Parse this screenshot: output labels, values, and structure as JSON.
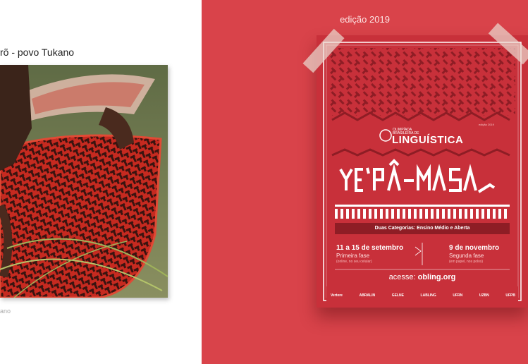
{
  "left": {
    "caption": "rõ - povo Tukano",
    "small_caption": "ano"
  },
  "right": {
    "edition": "edição 2019"
  },
  "poster": {
    "olympiad_line1": "OLIMPÍADA",
    "olympiad_line2": "BRASILEIRA DE",
    "linguistica": "LINGUÍSTICA",
    "year_tag": "edição 2019",
    "title": "YE'PÂ-MASA",
    "categories": "Duas Categorias: Ensino Médio e Aberta",
    "phase1": {
      "date": "11 a 15 de setembro",
      "label": "Primeira fase",
      "note": "(online, no seu celular)"
    },
    "phase2": {
      "date": "9 de novembro",
      "label": "Segunda fase",
      "note": "(em papel, nos polos)"
    },
    "acesse_label": "acesse:",
    "acesse_url": "obling.org",
    "logos": [
      "Vertere",
      "ABRALIN",
      "GELNE",
      "LABLING",
      "UFRN",
      "UZBN",
      "UFPB"
    ]
  },
  "colors": {
    "background_red": "#d9434a",
    "poster_red": "#c8303a",
    "pattern_dark": "#8e1d25"
  }
}
